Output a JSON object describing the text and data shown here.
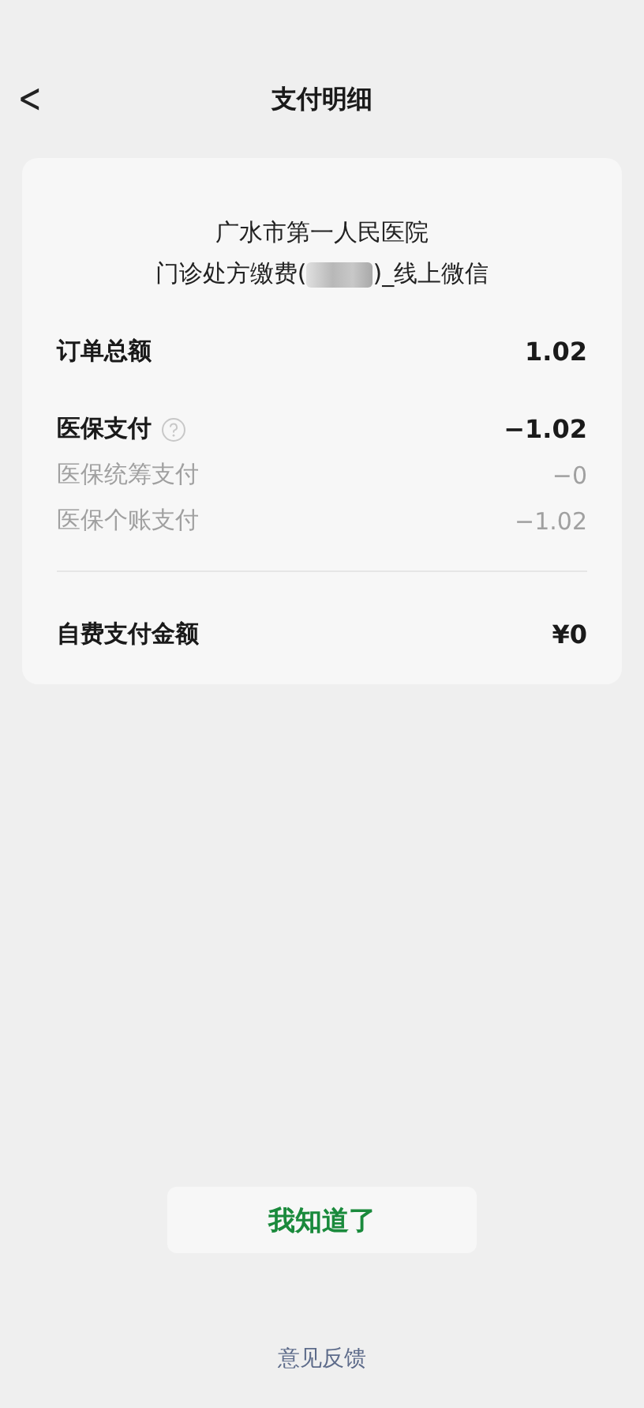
{
  "header": {
    "back": "<",
    "title": "支付明细"
  },
  "card": {
    "hospital": "广水市第一人民医院",
    "subtitle_start": "门诊处方缴费(",
    "subtitle_redacted": true,
    "subtitle_end": ")_线上微信",
    "sections": [
      {
        "divider": false,
        "rows": [
          {
            "kind": "main",
            "label": "订单总额",
            "value": "1.02",
            "help": false
          }
        ]
      },
      {
        "divider": false,
        "rows": [
          {
            "kind": "main",
            "label": "医保支付",
            "value": "−1.02",
            "help": true
          },
          {
            "kind": "sub",
            "label": "医保统筹支付",
            "value": "−0",
            "help": false
          },
          {
            "kind": "sub",
            "label": "医保个账支付",
            "value": "−1.02",
            "help": false
          }
        ]
      },
      {
        "divider": true,
        "rows": [
          {
            "kind": "main",
            "label": "自费支付金额",
            "value": "¥0",
            "help": false
          }
        ]
      }
    ]
  },
  "confirm_button": "我知道了",
  "feedback_link": "意见反馈"
}
